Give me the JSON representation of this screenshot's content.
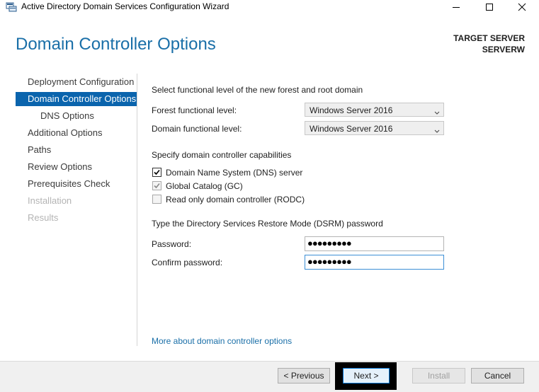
{
  "window": {
    "title": "Active Directory Domain Services Configuration Wizard",
    "controls": {
      "minimize": "minimize-icon",
      "maximize": "maximize-icon",
      "close": "close-icon"
    }
  },
  "header": {
    "title": "Domain Controller Options",
    "target_label": "TARGET SERVER",
    "target_server": "SERVERW"
  },
  "nav": {
    "items": [
      {
        "label": "Deployment Configuration",
        "state": "normal"
      },
      {
        "label": "Domain Controller Options",
        "state": "active"
      },
      {
        "label": "DNS Options",
        "state": "normal"
      },
      {
        "label": "Additional Options",
        "state": "normal"
      },
      {
        "label": "Paths",
        "state": "normal"
      },
      {
        "label": "Review Options",
        "state": "normal"
      },
      {
        "label": "Prerequisites Check",
        "state": "normal"
      },
      {
        "label": "Installation",
        "state": "disabled"
      },
      {
        "label": "Results",
        "state": "disabled"
      }
    ]
  },
  "functional": {
    "heading": "Select functional level of the new forest and root domain",
    "forest_label": "Forest functional level:",
    "forest_value": "Windows Server 2016",
    "domain_label": "Domain functional level:",
    "domain_value": "Windows Server 2016"
  },
  "capabilities": {
    "heading": "Specify domain controller capabilities",
    "dns": {
      "label": "Domain Name System (DNS) server",
      "checked": true
    },
    "gc": {
      "label": "Global Catalog (GC)",
      "checked": true
    },
    "rodc": {
      "label": "Read only domain controller (RODC)",
      "checked": false
    }
  },
  "dsrm": {
    "heading": "Type the Directory Services Restore Mode (DSRM) password",
    "password_label": "Password:",
    "password_value": "●●●●●●●●●",
    "confirm_label": "Confirm password:",
    "confirm_value": "●●●●●●●●●"
  },
  "link": {
    "text": "More about domain controller options"
  },
  "footer": {
    "previous": "< Previous",
    "next": "Next >",
    "install": "Install",
    "cancel": "Cancel"
  },
  "colors": {
    "accent": "#0a64ad",
    "title_blue": "#1a6fa8",
    "disabled_text": "#b4b4b4"
  }
}
